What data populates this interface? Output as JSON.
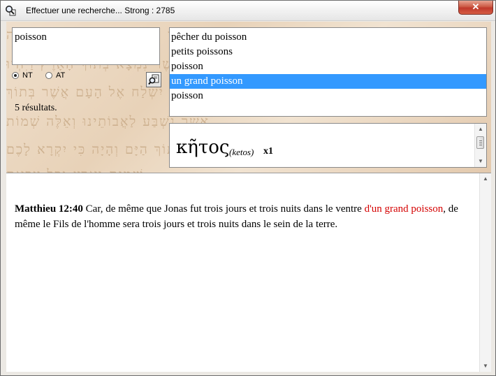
{
  "window": {
    "title": "Effectuer une recherche... Strong : 2785",
    "close_label": "✕"
  },
  "search": {
    "value": "poisson",
    "options": [
      {
        "label": "NT",
        "checked": true
      },
      {
        "label": "AT",
        "checked": false
      }
    ],
    "results_count": "5 résultats."
  },
  "results": {
    "items": [
      {
        "label": "pêcher du poisson",
        "selected": false
      },
      {
        "label": "petits poissons",
        "selected": false
      },
      {
        "label": "poisson",
        "selected": false
      },
      {
        "label": "un grand poisson",
        "selected": true
      },
      {
        "label": "poisson",
        "selected": false
      }
    ]
  },
  "strong": {
    "greek": "κῆτος",
    "transliteration": "(ketos)",
    "occurrences": "x1"
  },
  "verse": {
    "reference": "Matthieu 12:40",
    "text_before": " Car, de même que Jonas fut trois jours et trois nuits dans le ventre ",
    "highlight": "d'un grand poisson",
    "text_after": ", de même le Fils de l'homme sera trois jours et trois nuits dans le sein de la terre."
  },
  "colors": {
    "selection": "#3399ff",
    "highlight_text": "#d40000",
    "parchment": "#e8d2b8"
  },
  "icons": {
    "app": "magnifier-document-icon",
    "search_button": "magnifier-document-icon"
  }
}
